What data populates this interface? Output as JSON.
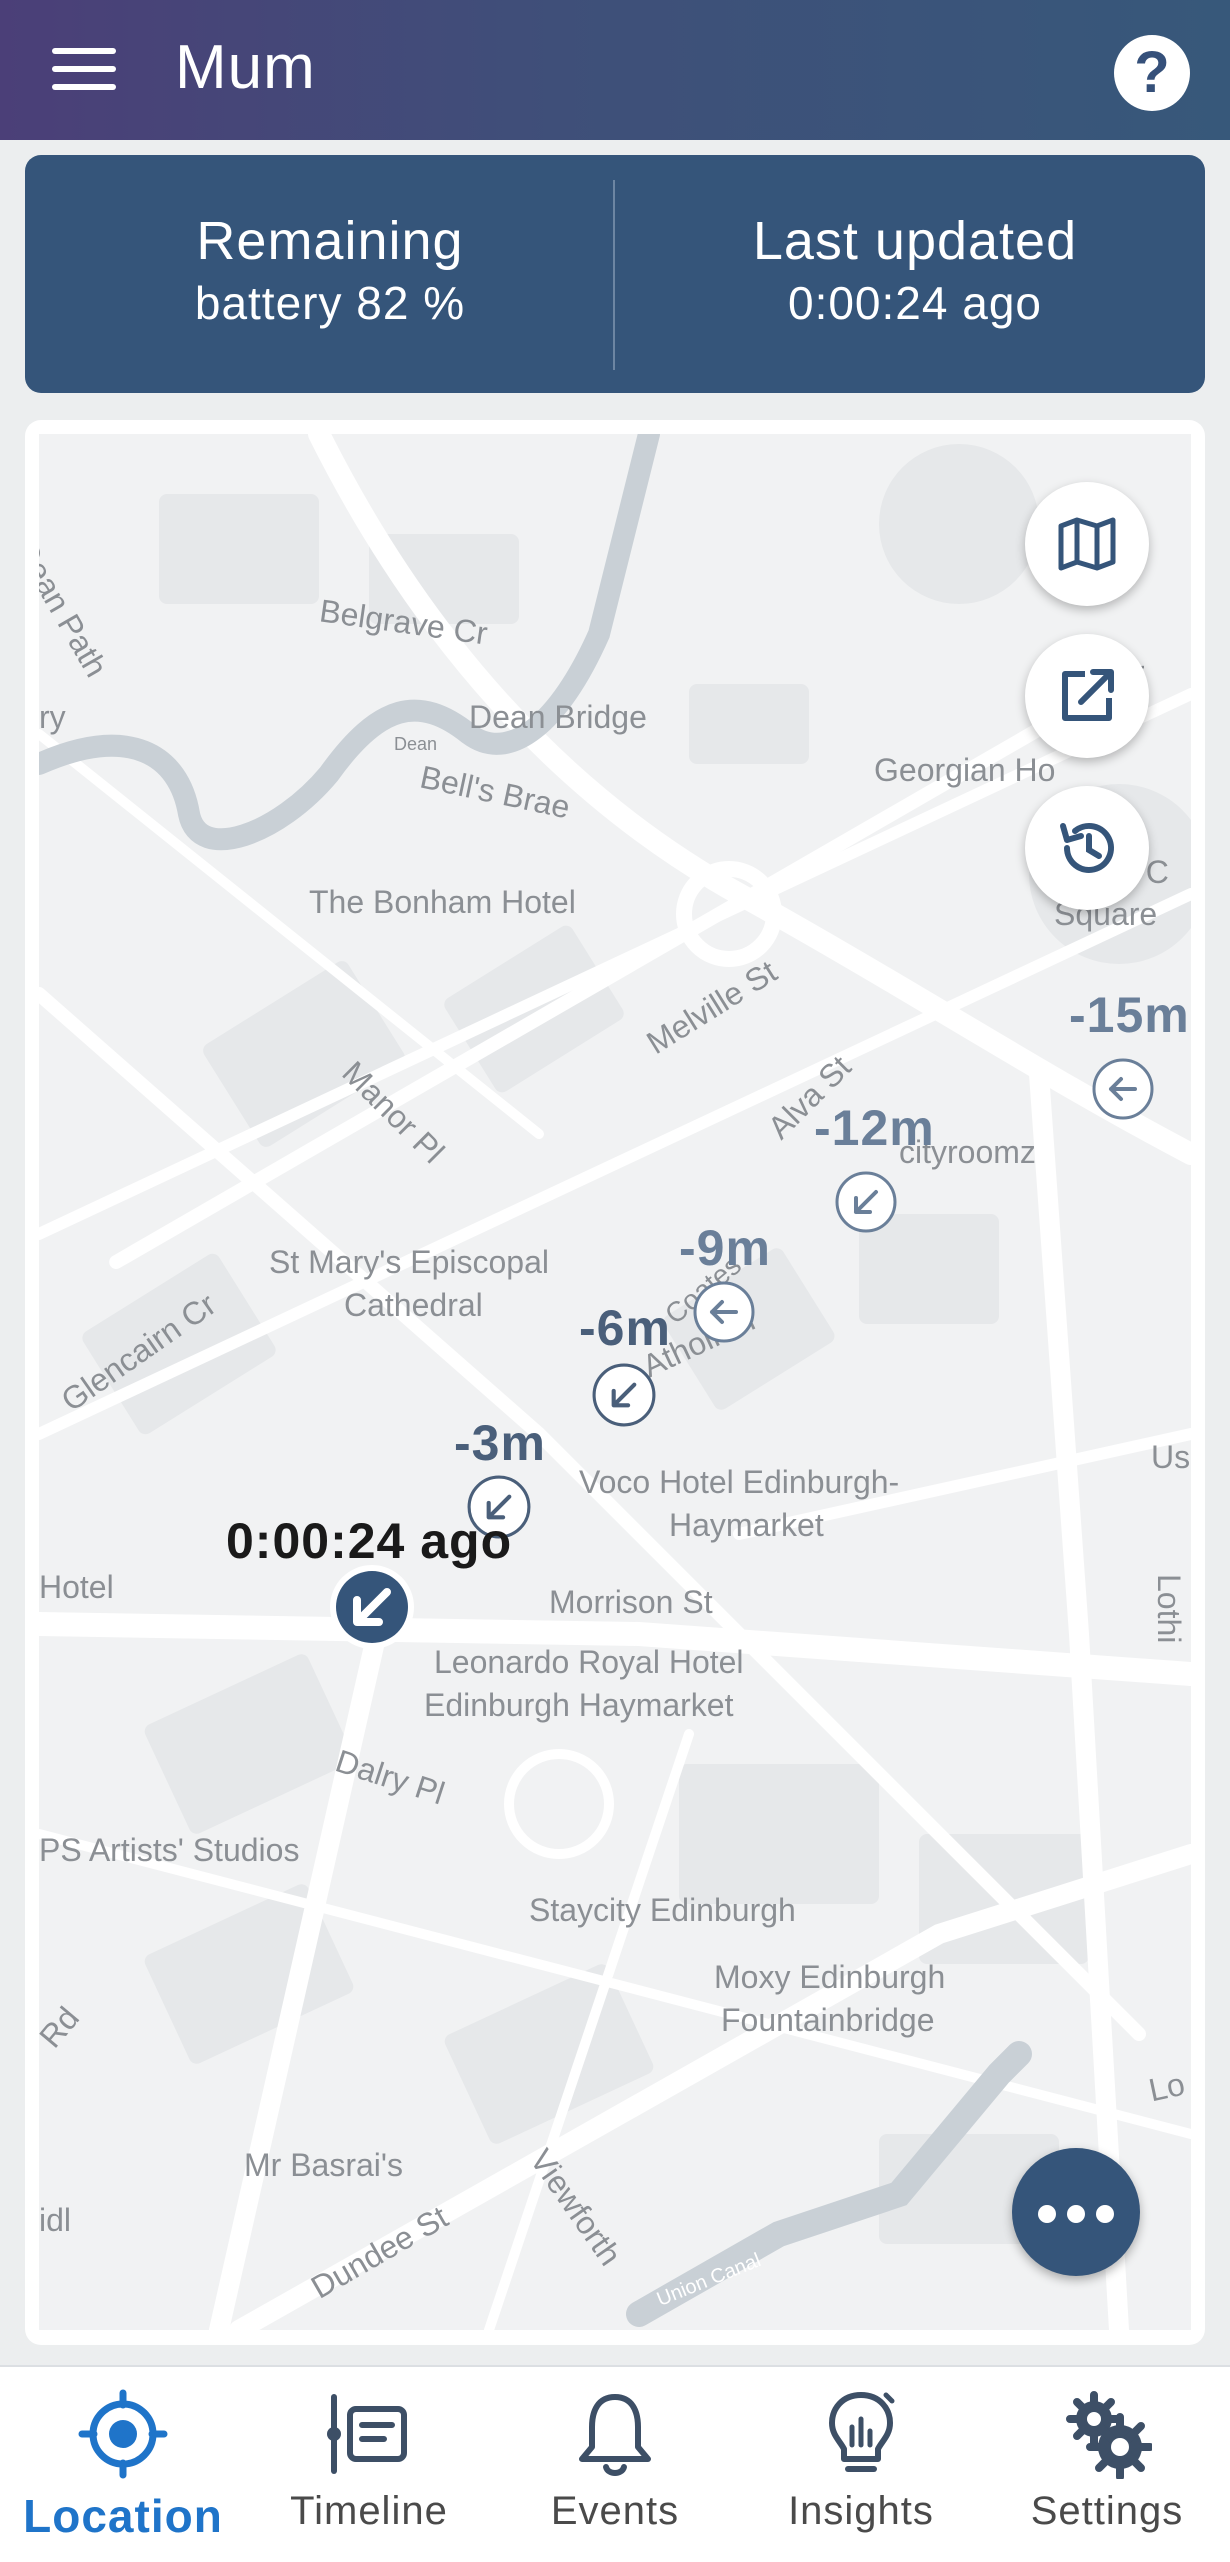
{
  "header": {
    "title": "Mum"
  },
  "stats": {
    "battery_label": "Remaining",
    "battery_value": "battery 82 %",
    "updated_label": "Last updated",
    "updated_value": "0:00:24 ago"
  },
  "map": {
    "labels": {
      "dean_path": "Dean Path",
      "belgrave": "Belgrave Cr",
      "dean_bridge": "Dean Bridge",
      "dean": "Dean",
      "bells_brae": "Bell's Brae",
      "georgian": "Georgian Ho",
      "bonham": "The Bonham Hotel",
      "square": "Square",
      "melville": "Melville St",
      "alva": "Alva St",
      "manor": "Manor Pl",
      "cityroomz": "cityroomz",
      "st_marys_1": "St Mary's Episcopal",
      "st_marys_2": "Cathedral",
      "glencairn": "Glencairn Cr",
      "atholl": "Atholl Cr",
      "coates": "Coates",
      "voco_1": "Voco Hotel Edinburgh-",
      "voco_2": "Haymarket",
      "hotel": "Hotel",
      "morrison": "Morrison St",
      "leonardo_1": "Leonardo Royal Hotel",
      "leonardo_2": "Edinburgh Haymarket",
      "dalry": "Dalry Pl",
      "wasps": "PS Artists' Studios",
      "staycity": "Staycity Edinburgh",
      "moxy_1": "Moxy Edinburgh",
      "moxy_2": "Fountainbridge",
      "mr_basrai": "Mr Basrai's",
      "dundee": "Dundee St",
      "viewforth": "Viewforth",
      "union_canal": "Union Canal",
      "rd": "Rd",
      "idl": "idl",
      "ry": "ry",
      "us": "Us",
      "lo": "Lo",
      "dir": "dir",
      "n_c": "n C",
      "loth": "Lothi"
    },
    "trail": [
      {
        "label": "-15m"
      },
      {
        "label": "-12m"
      },
      {
        "label": "-9m"
      },
      {
        "label": "-6m"
      },
      {
        "label": "-3m"
      }
    ],
    "current_label": "0:00:24 ago",
    "icons": {
      "map_type": "map-icon",
      "open_external": "external-link-icon",
      "history": "history-icon",
      "more": "more-icon"
    }
  },
  "nav": [
    {
      "label": "Location",
      "icon": "location-crosshair-icon",
      "active": true
    },
    {
      "label": "Timeline",
      "icon": "timeline-icon",
      "active": false
    },
    {
      "label": "Events",
      "icon": "bell-icon",
      "active": false
    },
    {
      "label": "Insights",
      "icon": "lightbulb-icon",
      "active": false
    },
    {
      "label": "Settings",
      "icon": "gears-icon",
      "active": false
    }
  ],
  "colors": {
    "header_start": "#4b3f78",
    "header_end": "#37587a",
    "accent": "#35557a",
    "active": "#1f74c9"
  }
}
